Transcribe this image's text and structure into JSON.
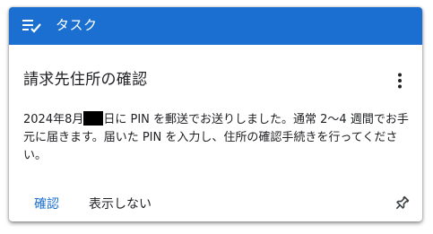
{
  "header": {
    "icon": "task-list-check-icon",
    "title": "タスク",
    "color": "#1a6fd1"
  },
  "task": {
    "title": "請求先住所の確認",
    "message_part1": "2024年8月",
    "message_part2": "日に PIN を郵送でお送りしました。通常 2〜4 週間でお手元に届きます。届いた PIN を入力し、住所の確認手続きを行ってください。",
    "menu_icon": "more-vert-icon"
  },
  "actions": {
    "confirm_label": "確認",
    "dismiss_label": "表示しない",
    "pin_icon": "pin-icon"
  }
}
